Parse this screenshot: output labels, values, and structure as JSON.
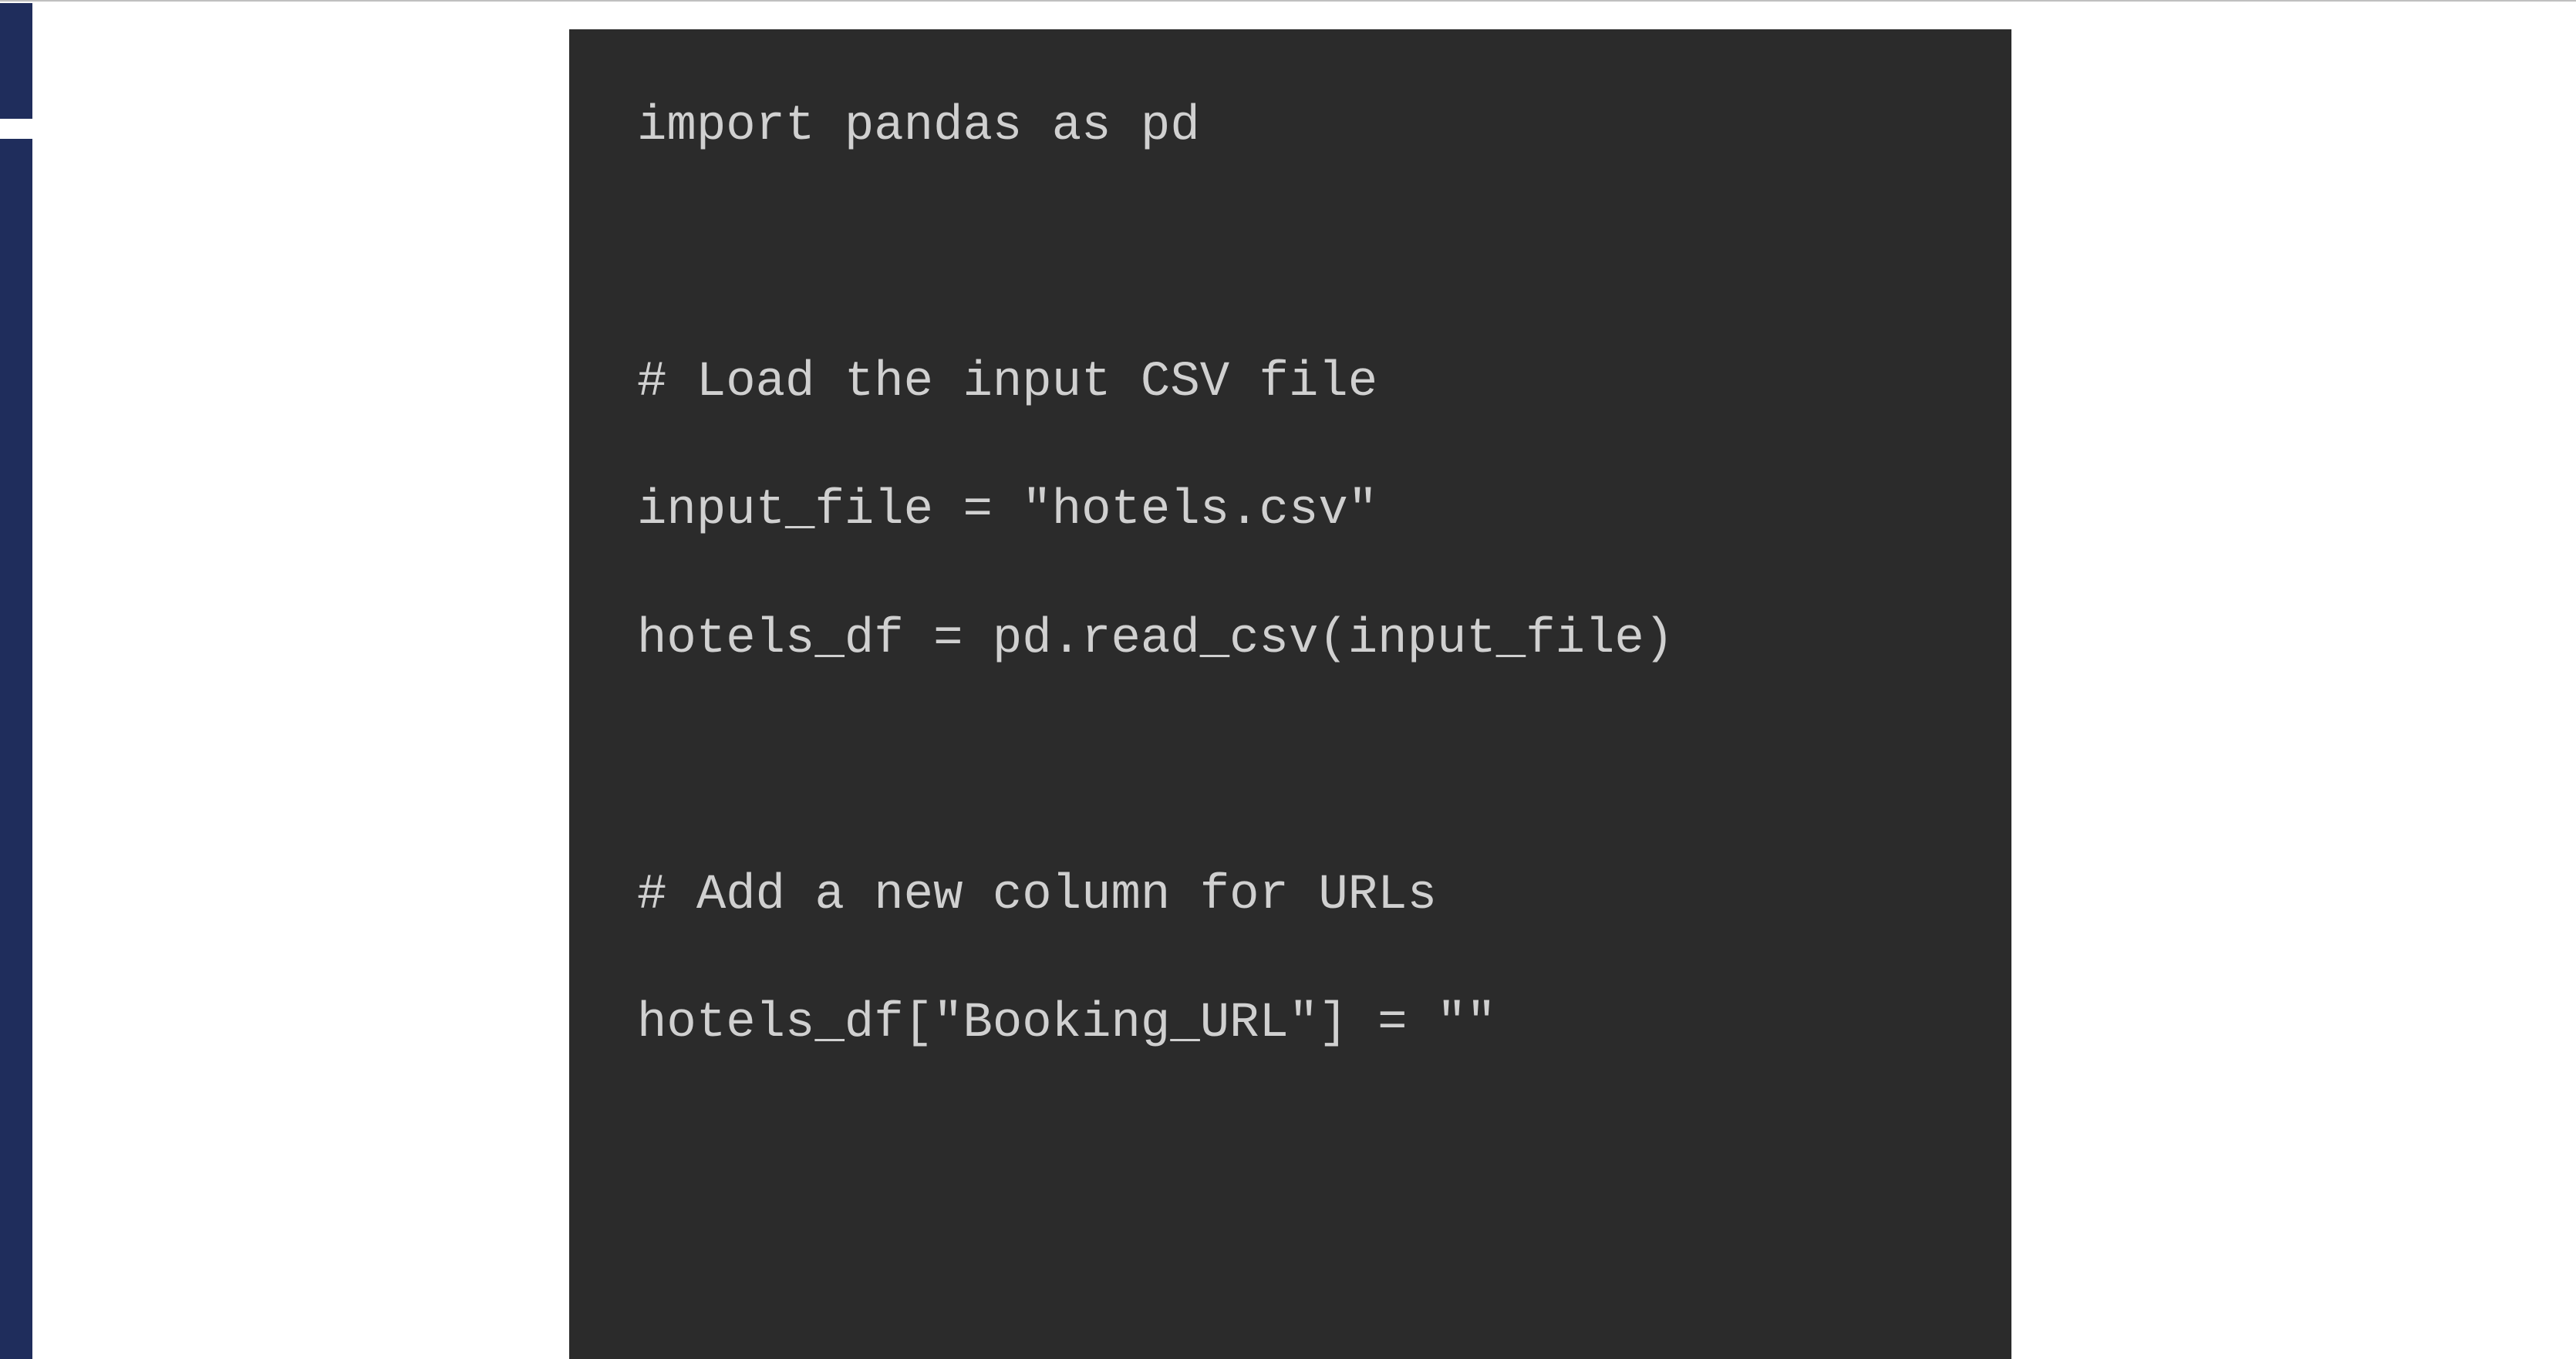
{
  "code": {
    "line1": "import pandas as pd",
    "line2": "# Load the input CSV file",
    "line3": "input_file = \"hotels.csv\"",
    "line4": "hotels_df = pd.read_csv(input_file)",
    "line5": "# Add a new column for URLs",
    "line6": "hotels_df[\"Booking_URL\"] = \"\""
  }
}
